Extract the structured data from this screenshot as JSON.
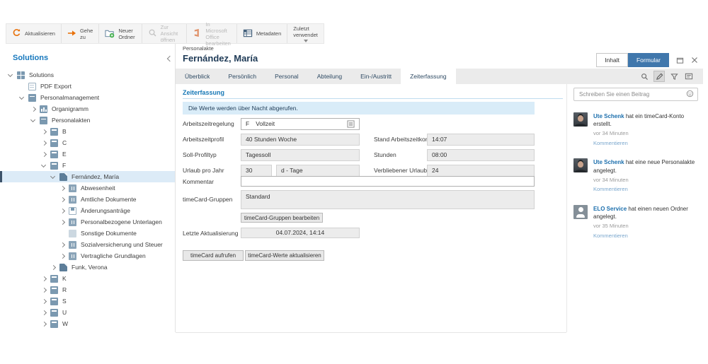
{
  "colors": {
    "accent_blue": "#1778b6",
    "formular_button_blue": "#4077ac",
    "banner_bg": "#d9ecf8",
    "tree_selection_bg": "#dcebf7",
    "link_blue": "#7aa7cd",
    "feed_name_blue": "#1c6fad",
    "toolbar_icon_orange": "#e8710a",
    "office_icon_orange": "#d83b01"
  },
  "toolbar": {
    "buttons": [
      {
        "label": "Aktualisieren",
        "icon": "refresh-icon",
        "enabled": true
      },
      {
        "label": "Gehe zu",
        "icon": "goto-arrow-icon",
        "enabled": true
      },
      {
        "label": "Neuer Ordner",
        "icon": "new-folder-icon",
        "enabled": true
      },
      {
        "label": "Zur Ansicht öffnen",
        "icon": "open-view-icon",
        "enabled": false
      },
      {
        "label": "In Microsoft Office bearbeiten",
        "icon": "office-icon",
        "enabled": false
      },
      {
        "label": "Metadaten",
        "icon": "metadata-table-icon",
        "enabled": true
      },
      {
        "label": "Zuletzt verwendet",
        "icon": "caret-down-icon",
        "enabled": true
      }
    ]
  },
  "sidebar": {
    "title": "Solutions",
    "tree": [
      {
        "label": "Solutions"
      },
      {
        "label": "PDF Export"
      },
      {
        "label": "Personalmanagement"
      },
      {
        "label": "Organigramm"
      },
      {
        "label": "Personalakten"
      },
      {
        "label": "B"
      },
      {
        "label": "C"
      },
      {
        "label": "E"
      },
      {
        "label": "F"
      },
      {
        "label": "Fernández, María",
        "selected": true
      },
      {
        "label": "Abwesenheit"
      },
      {
        "label": "Amtliche Dokumente"
      },
      {
        "label": "Änderungsanträge"
      },
      {
        "label": "Personalbezogene Unterlagen"
      },
      {
        "label": "Sonstige Dokumente"
      },
      {
        "label": "Sozialversicherung und Steuer"
      },
      {
        "label": "Vertragliche Grundlagen"
      },
      {
        "label": "Funk, Verona"
      },
      {
        "label": "K"
      },
      {
        "label": "R"
      },
      {
        "label": "S"
      },
      {
        "label": "U"
      },
      {
        "label": "W"
      }
    ]
  },
  "header": {
    "breadcrumb": "Personalakte",
    "title": "Fernández, María",
    "view_content_label": "Inhalt",
    "view_form_label": "Formular"
  },
  "tabs": {
    "items": [
      "Überblick",
      "Persönlich",
      "Personal",
      "Abteilung",
      "Ein-/Austritt",
      "Zeiterfassung"
    ],
    "active": "Zeiterfassung"
  },
  "form": {
    "section_title": "Zeiterfassung",
    "banner": "Die Werte werden über Nacht abgerufen.",
    "fields": {
      "arbeitszeitregelung": {
        "label": "Arbeitszeitregelung",
        "code": "F",
        "value": "Vollzeit"
      },
      "arbeitszeitprofil": {
        "label": "Arbeitszeitprofil",
        "value": "40 Stunden Woche"
      },
      "stand_arbeitszeitkonto": {
        "label": "Stand Arbeitszeitkonto",
        "value": "14:07"
      },
      "soll_profiltyp": {
        "label": "Soll-Profiltyp",
        "value": "Tagessoll"
      },
      "stunden": {
        "label": "Stunden",
        "value": "08:00"
      },
      "urlaub_pro_jahr": {
        "label": "Urlaub pro Jahr",
        "value": "30",
        "unit": "d - Tage"
      },
      "verbliebener_urlaub": {
        "label": "Verbliebener Urlaub",
        "value": "24"
      },
      "kommentar": {
        "label": "Kommentar",
        "value": ""
      },
      "timecard_gruppen": {
        "label": "timeCard-Gruppen",
        "value": "Standard"
      },
      "letzte_aktualisierung": {
        "label": "Letzte Aktualisierung",
        "value": "04.07.2024, 14:14"
      }
    },
    "buttons": {
      "edit_groups": "timeCard-Gruppen bearbeiten",
      "open_timecard": "timeCard aufrufen",
      "refresh_values": "timeCard-Werte aktualisieren"
    }
  },
  "feed": {
    "composer_placeholder": "Schreiben Sie einen Beitrag",
    "items": [
      {
        "name": "Ute Schenk",
        "action": "hat ein timeCard-Konto erstellt.",
        "time": "vor 34 Minuten",
        "comment_label": "Kommentieren"
      },
      {
        "name": "Ute Schenk",
        "action": "hat eine neue Personalakte angelegt.",
        "time": "vor 34 Minuten",
        "comment_label": "Kommentieren"
      },
      {
        "name": "ELO Service",
        "action": "hat einen neuen Ordner angelegt.",
        "time": "vor 35 Minuten",
        "comment_label": "Kommentieren"
      }
    ]
  }
}
